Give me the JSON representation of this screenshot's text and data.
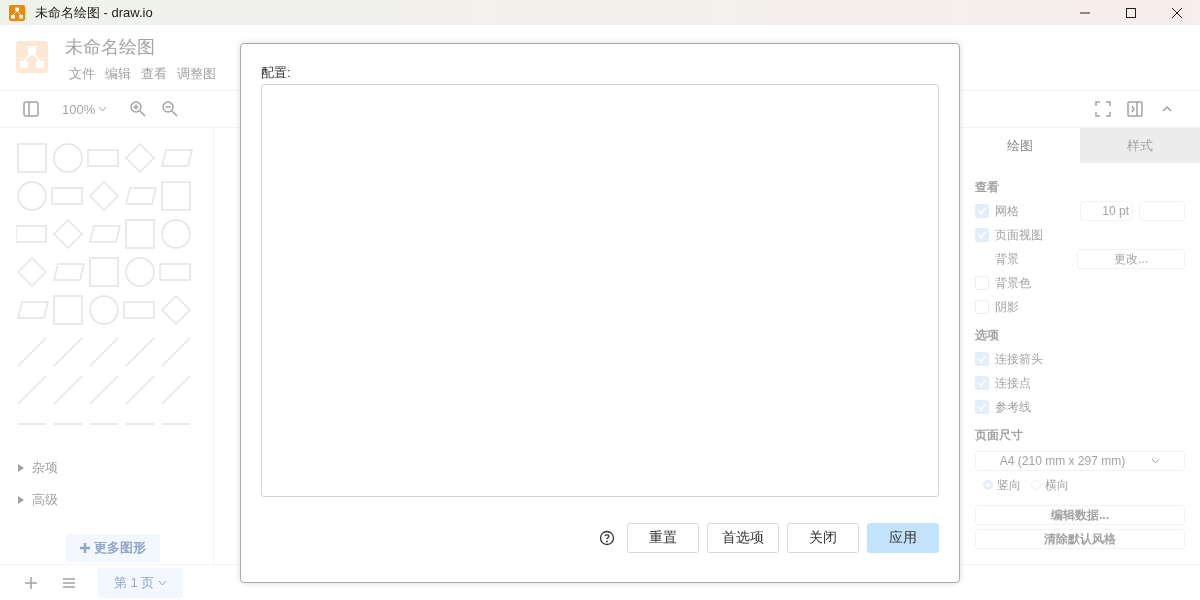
{
  "window": {
    "title": "未命名绘图 - draw.io"
  },
  "app": {
    "title": "未命名绘图",
    "menus": [
      "文件",
      "编辑",
      "查看",
      "调整图"
    ]
  },
  "toolbar": {
    "zoom": "100%"
  },
  "sidebar": {
    "sections": [
      {
        "label": "杂项",
        "expanded": false
      },
      {
        "label": "高级",
        "expanded": false
      }
    ],
    "more_shapes": "更多图形"
  },
  "format_panel": {
    "tabs": [
      {
        "label": "绘图",
        "selected": true
      },
      {
        "label": "样式",
        "selected": false
      }
    ],
    "view": {
      "heading": "查看",
      "items": [
        {
          "kind": "grid",
          "label": "网格",
          "checked": true,
          "value": "10 pt"
        },
        {
          "kind": "check",
          "label": "页面视图",
          "checked": true
        },
        {
          "kind": "button",
          "label": "背景",
          "button": "更改..."
        },
        {
          "kind": "check",
          "label": "背景色",
          "checked": false
        },
        {
          "kind": "check",
          "label": "阴影",
          "checked": false
        }
      ]
    },
    "options": {
      "heading": "选项",
      "items": [
        {
          "label": "连接箭头",
          "checked": true
        },
        {
          "label": "连接点",
          "checked": true
        },
        {
          "label": "参考线",
          "checked": true
        }
      ]
    },
    "page_size": {
      "heading": "页面尺寸",
      "value": "A4 (210 mm x 297 mm)",
      "orientations": [
        {
          "label": "竖向",
          "selected": true
        },
        {
          "label": "横向",
          "selected": false
        }
      ]
    },
    "buttons": [
      "编辑数据...",
      "清除默认风格"
    ]
  },
  "page_tabs": [
    {
      "label": "第 1 页",
      "selected": true
    }
  ],
  "dialog": {
    "label": "配置:",
    "buttons": [
      {
        "label": "重置",
        "kind": "default"
      },
      {
        "label": "首选项",
        "kind": "default"
      },
      {
        "label": "关闭",
        "kind": "default"
      },
      {
        "label": "应用",
        "kind": "primary"
      }
    ]
  }
}
